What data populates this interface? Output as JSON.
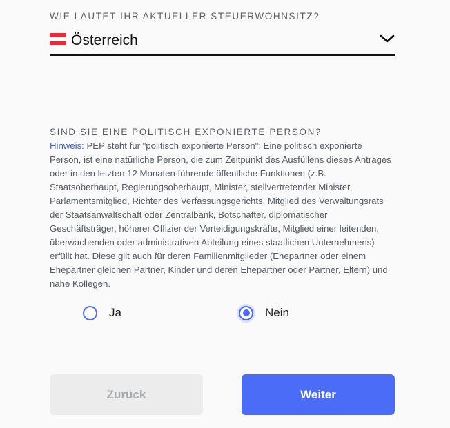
{
  "residence": {
    "label": "WIE LAUTET IHR AKTUELLER STEUERWOHNSITZ?",
    "selected": "Österreich",
    "flag_icon": "austria-flag-icon",
    "flag_colors": [
      "#ed2939",
      "#ffffff",
      "#ed2939"
    ],
    "chevron_icon": "chevron-down-icon"
  },
  "pep": {
    "label": "SIND SIE EINE POLITISCH EXPONIERTE PERSON?",
    "hint_prefix": "Hinweis:",
    "hint_text": " PEP steht für \"politisch exponierte Person\": Eine politisch exponierte Person, ist eine natürliche Person, die zum Zeitpunkt des Ausfüllens dieses Antrages oder in den letzten 12 Monaten führende öffentliche Funktionen (z.B. Staatsoberhaupt, Regierungsoberhaupt, Minister, stellvertretender Minister, Parlamentsmitglied, Richter des Verfassungsgerichts, Mitglied des Verwaltungsrats der Staatsanwaltschaft oder Zentralbank, Botschafter, diplomatischer Geschäftsträger, höherer Offizier der Verteidigungskräfte, Mitglied einer leitenden, überwachenden oder administrativen Abteilung eines staatlichen Unternehmens) erfüllt hat. Diese gilt auch für deren Familienmitglieder (Ehepartner oder einem Ehepartner gleichen Partner, Kinder und deren Ehepartner oder Partner, Eltern) und nahe Kollegen.",
    "options": [
      {
        "label": "Ja",
        "selected": false
      },
      {
        "label": "Nein",
        "selected": true
      }
    ]
  },
  "buttons": {
    "back_label": "Zurück",
    "next_label": "Weiter"
  },
  "colors": {
    "accent": "#4a6cf7",
    "disabled_bg": "#ececec",
    "hint": "#3d5bd9"
  }
}
